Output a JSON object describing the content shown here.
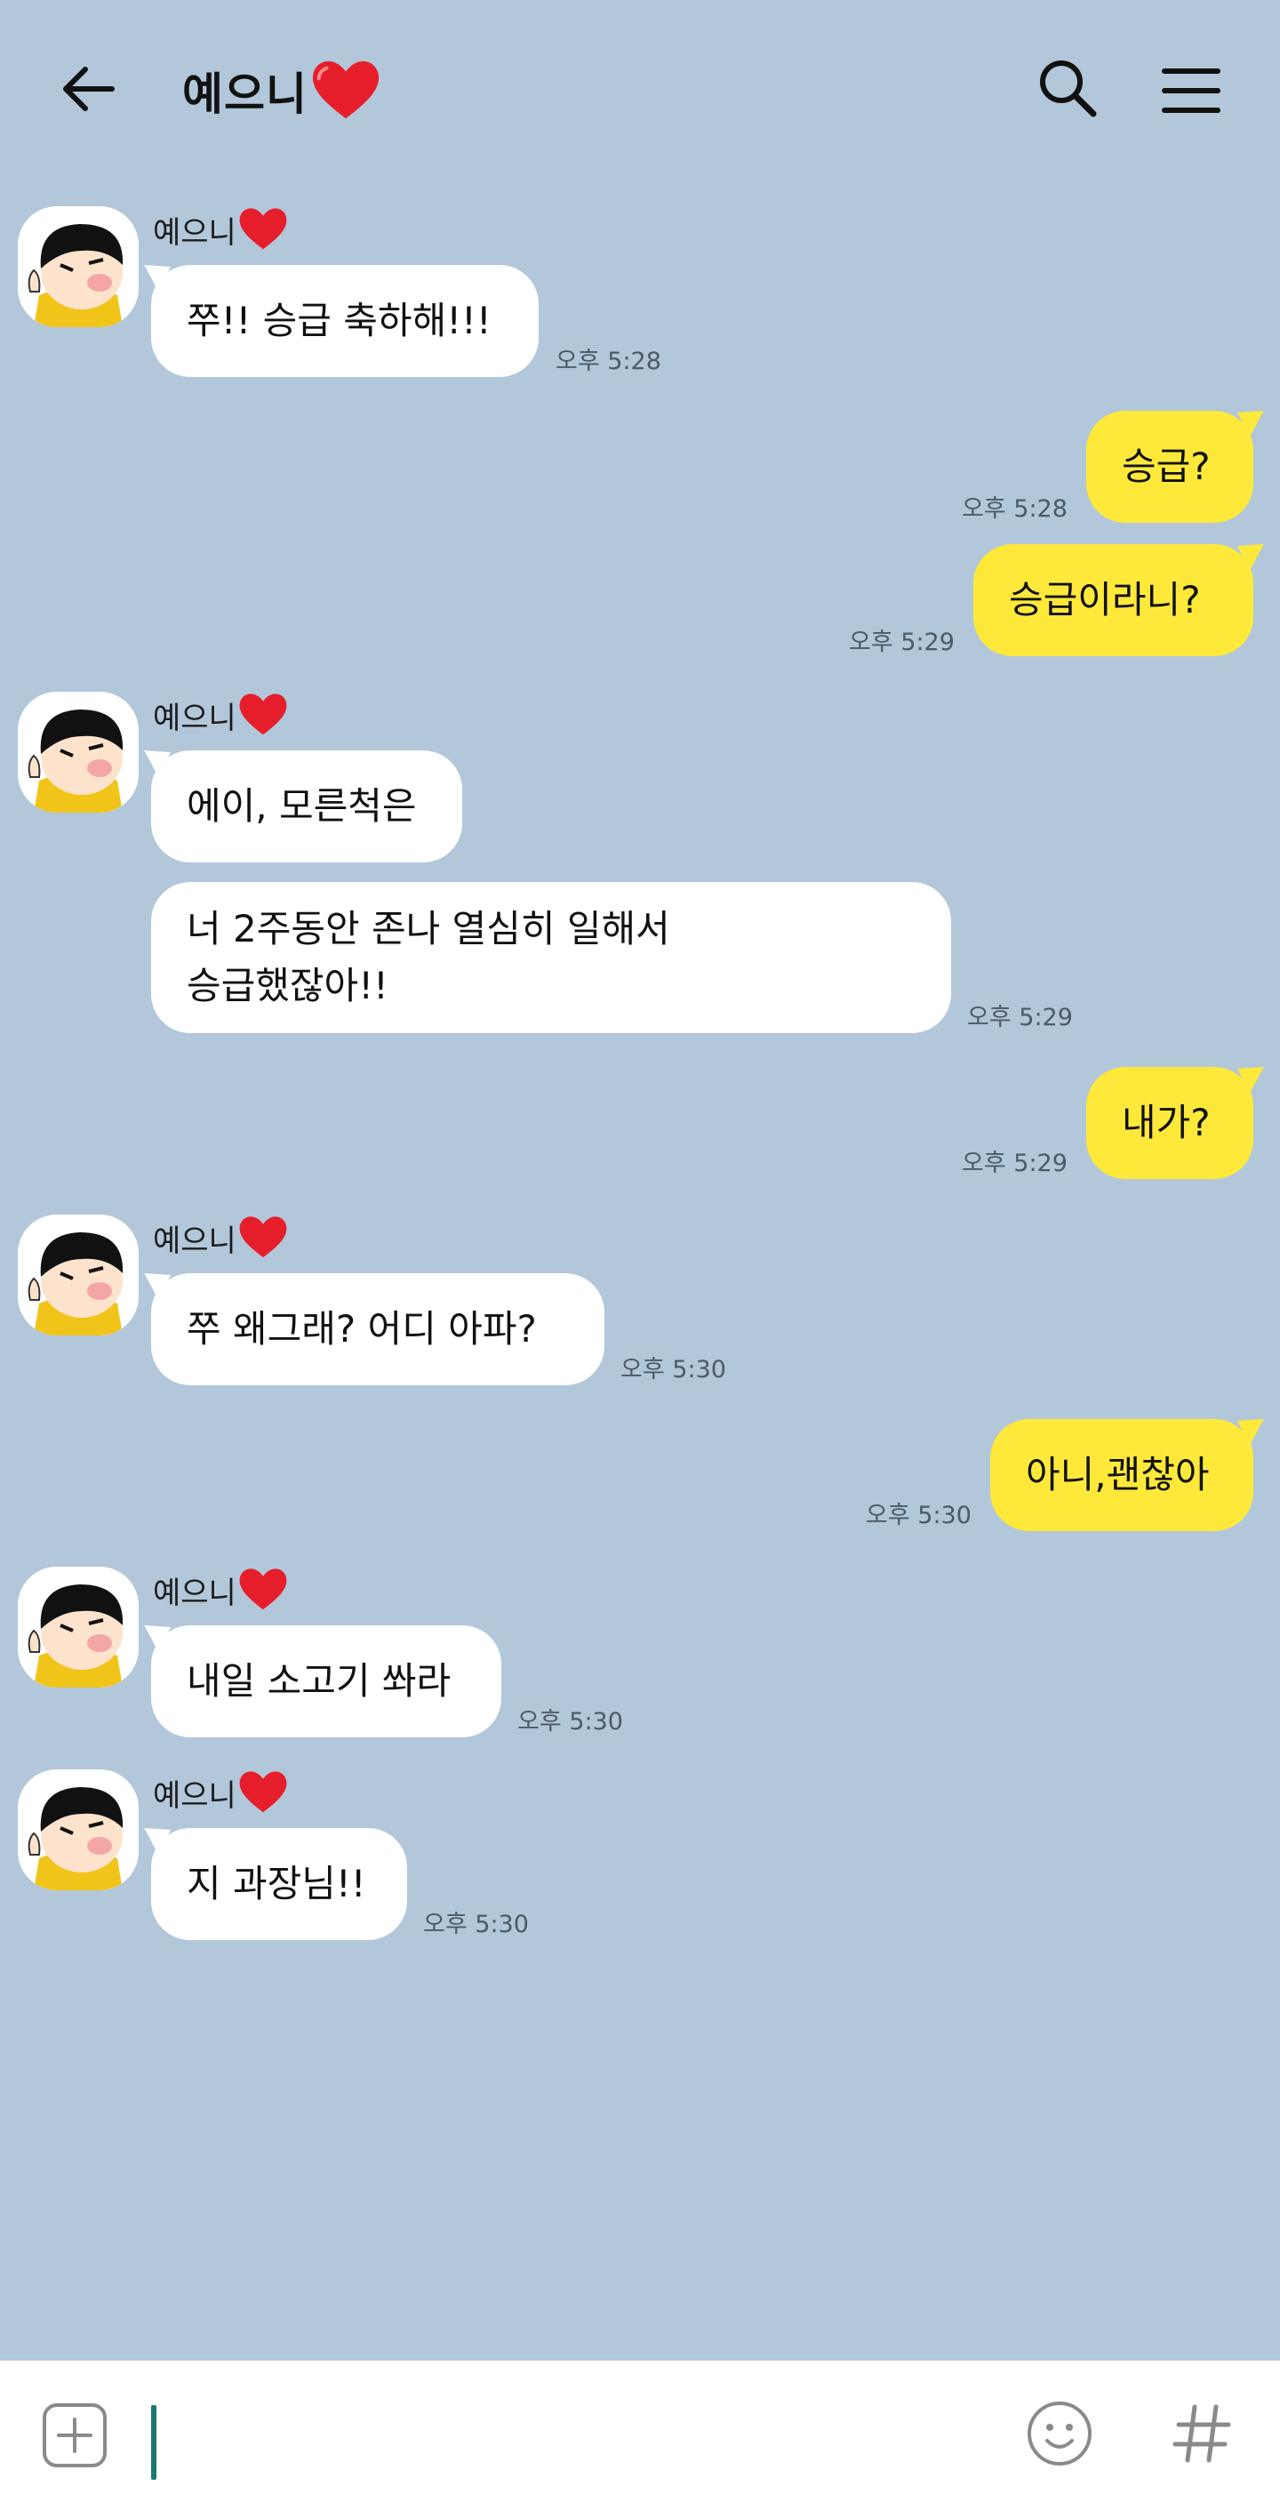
{
  "header": {
    "title": "예으니",
    "back_icon": "arrow-left-icon",
    "search_icon": "search-icon",
    "menu_icon": "hamburger-menu-icon"
  },
  "colors": {
    "background": "#b2c7da",
    "incoming_bubble": "#ffffff",
    "outgoing_bubble": "#fee93a",
    "cursor": "#1a7a6e"
  },
  "messages": [
    {
      "direction": "incoming",
      "sender": "예으니",
      "text": "쭈!! 승급 축하해!!!",
      "time": "오후 5:28"
    },
    {
      "direction": "outgoing",
      "text": "승급?",
      "time": "오후 5:28"
    },
    {
      "direction": "outgoing",
      "text": "승급이라니?",
      "time": "오후 5:29"
    },
    {
      "direction": "incoming",
      "sender": "예으니",
      "text": "에이, 모른척은"
    },
    {
      "direction": "incoming",
      "text": "너 2주동안 존나 열심히 일해서\n승급했잖아!!",
      "time": "오후 5:29"
    },
    {
      "direction": "outgoing",
      "text": "내가?",
      "time": "오후 5:29"
    },
    {
      "direction": "incoming",
      "sender": "예으니",
      "text": "쭈 왜그래? 어디 아파?",
      "time": "오후 5:30"
    },
    {
      "direction": "outgoing",
      "text": "아니,괜찮아",
      "time": "오후 5:30"
    },
    {
      "direction": "incoming",
      "sender": "예으니",
      "text": "내일 소고기 쏴라",
      "time": "오후 5:30"
    },
    {
      "direction": "incoming",
      "sender": "예으니",
      "text": "지 과장님!!",
      "time": "오후 5:30"
    }
  ],
  "input": {
    "value": "",
    "plus_icon": "plus-square-icon",
    "emoji_icon": "emoji-smile-icon",
    "hash_icon": "hashtag-icon"
  }
}
